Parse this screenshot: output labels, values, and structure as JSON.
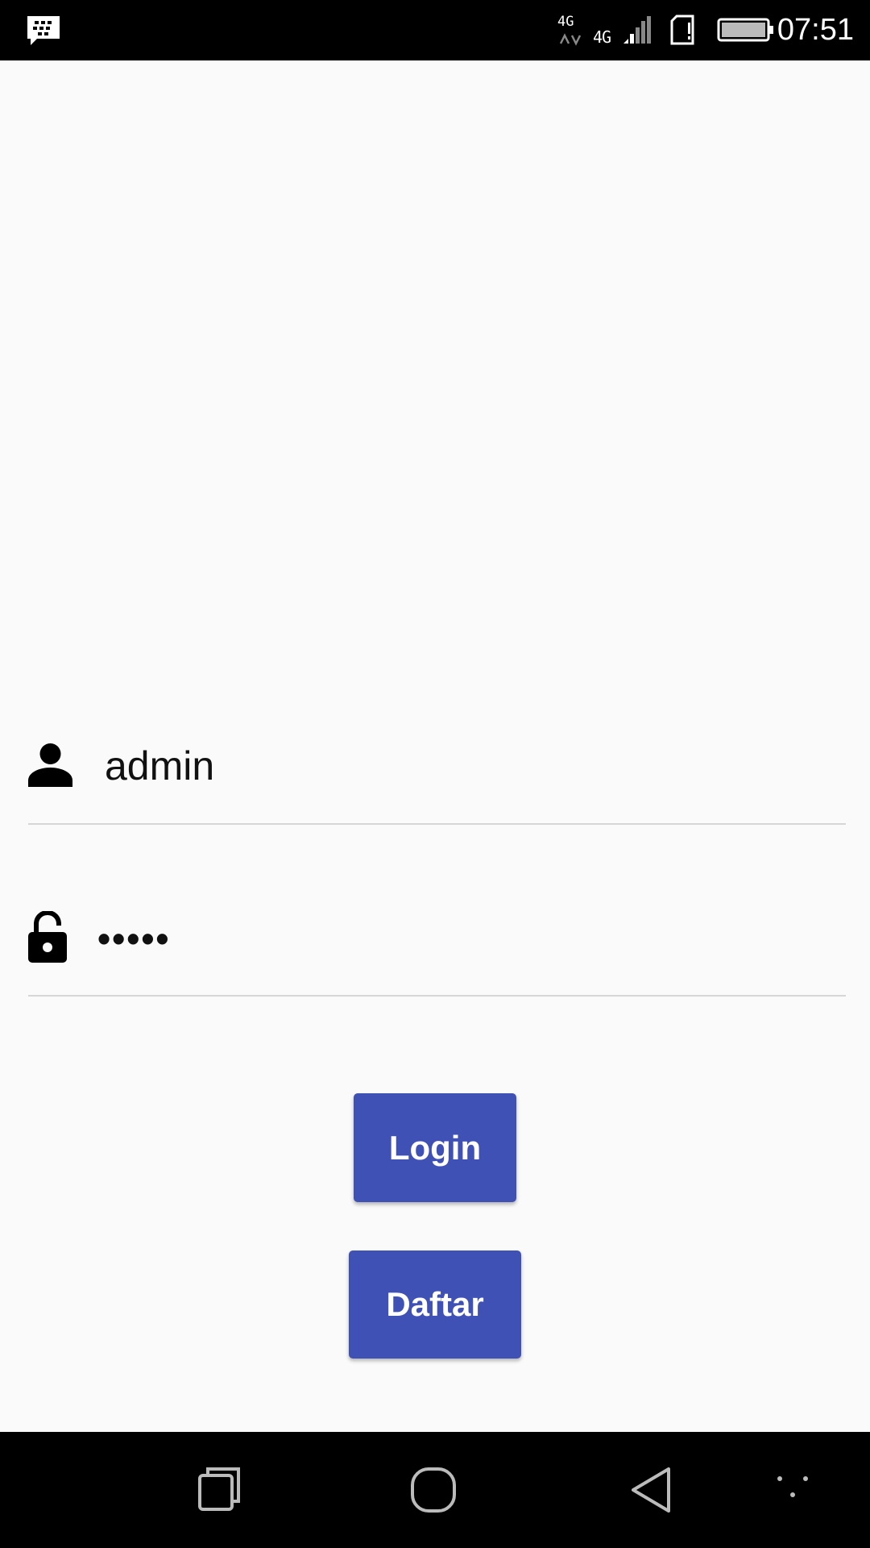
{
  "status_bar": {
    "time": "07:51",
    "network_primary": "4G",
    "network_secondary": "4G",
    "icons": [
      "bbm-icon",
      "network-4g-icon",
      "signal-icon",
      "sim-icon",
      "battery-icon"
    ]
  },
  "login_form": {
    "username": {
      "icon": "person-icon",
      "value": "admin"
    },
    "password": {
      "icon": "lock-open-icon",
      "value": "•••••"
    },
    "login_button": "Login",
    "register_button": "Daftar"
  },
  "nav_bar": {
    "icons": [
      "recents-icon",
      "home-icon",
      "back-icon",
      "more-icon"
    ]
  },
  "colors": {
    "primary": "#3f51b5",
    "background": "#fafafa",
    "status_bar": "#000000",
    "divider": "#d6d6d6"
  }
}
